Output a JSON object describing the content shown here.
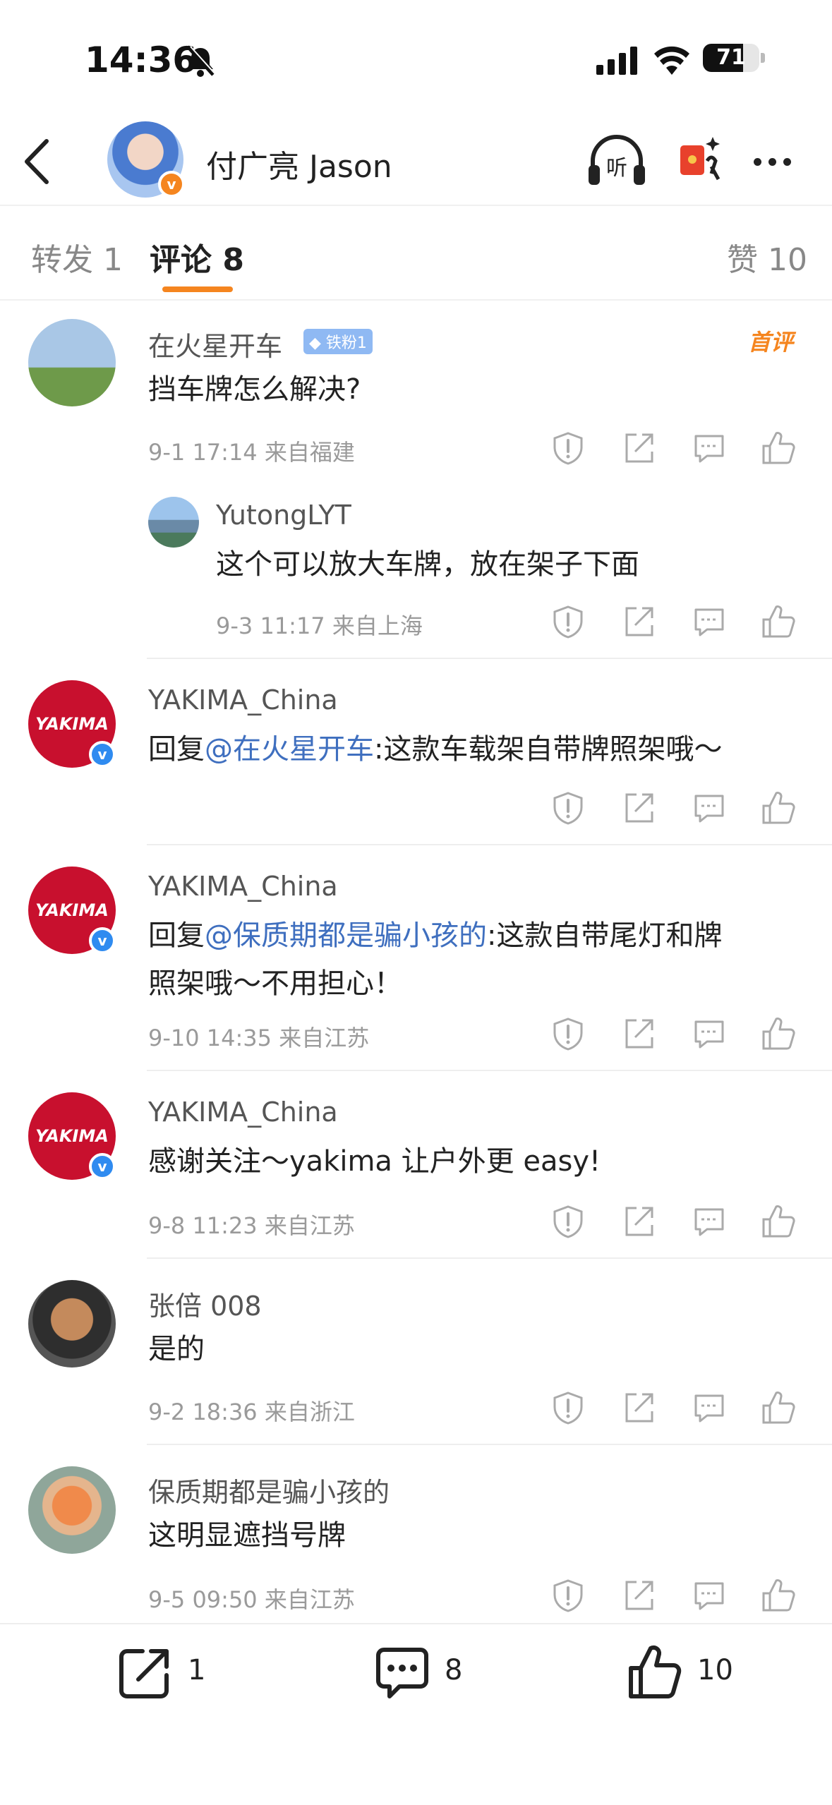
{
  "status_bar": {
    "time": "14:36",
    "battery": "71",
    "battery_level": 0.71
  },
  "header": {
    "name": "付广亮 Jason",
    "listen_label": "听"
  },
  "tabs": {
    "repost": "转发 1",
    "comments": "评论 8",
    "likes": "赞 10"
  },
  "comments": [
    {
      "user": "在火星开车",
      "badge": "铁粉1",
      "first_tag": "首评",
      "text": "挡车牌怎么解决?",
      "meta": "9-1 17:14 来自福建"
    },
    {
      "user": "YutongLYT",
      "text": "这个可以放大车牌，放在架子下面",
      "meta": "9-3 11:17 来自上海"
    },
    {
      "user": "YAKIMA_China",
      "reply_prefix": "回复",
      "mention": "@在火星开车",
      "text": ":这款车载架自带牌照架哦～",
      "avatar_text": "YAKIMA"
    },
    {
      "user": "YAKIMA_China",
      "reply_prefix": "回复",
      "mention": "@保质期都是骗小孩的",
      "text": ":这款自带尾灯和牌",
      "text2": "照架哦～不用担心！",
      "meta": "9-10 14:35 来自江苏",
      "avatar_text": "YAKIMA"
    },
    {
      "user": "YAKIMA_China",
      "text": "感谢关注～yakima 让户外更 easy!",
      "meta": "9-8 11:23 来自江苏",
      "avatar_text": "YAKIMA"
    },
    {
      "user": "张倍 008",
      "text": "是的",
      "meta": "9-2 18:36 来自浙江"
    },
    {
      "user": "保质期都是骗小孩的",
      "text": "这明显遮挡号牌",
      "meta": "9-5 09:50 来自江苏"
    }
  ],
  "bottom_bar": {
    "repost_count": "1",
    "comment_count": "8",
    "like_count": "10"
  },
  "colors": {
    "accent": "#f5851f",
    "mention": "#3f6fbf",
    "verified_blue": "#2f8bf0",
    "yakima_red": "#c8102e"
  }
}
